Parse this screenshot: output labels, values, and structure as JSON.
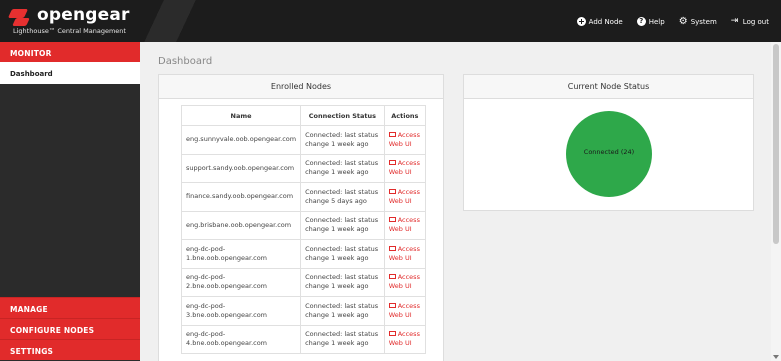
{
  "header": {
    "logo_text": "opengear",
    "logo_subtitle": "Lighthouse™ Central Management",
    "nav": [
      {
        "label": "Add Node",
        "icon": "plus-circle-icon"
      },
      {
        "label": "Help",
        "icon": "help-circle-icon"
      },
      {
        "label": "System",
        "icon": "gear-icon"
      },
      {
        "label": "Log out",
        "icon": "logout-icon"
      }
    ]
  },
  "sidebar": {
    "monitor_label": "MONITOR",
    "active_item": "Dashboard",
    "bottom_items": [
      "MANAGE",
      "CONFIGURE NODES",
      "SETTINGS"
    ]
  },
  "main": {
    "page_title": "Dashboard",
    "enrolled_title": "Enrolled Nodes",
    "status_title": "Current Node Status",
    "columns": [
      "Name",
      "Connection Status",
      "Actions"
    ],
    "rows": [
      {
        "name": "eng.sunnyvale.oob.opengear.com",
        "status": "Connected: last status change 1 week ago",
        "action": "Access Web UI"
      },
      {
        "name": "support.sandy.oob.opengear.com",
        "status": "Connected: last status change 1 week ago",
        "action": "Access Web UI"
      },
      {
        "name": "finance.sandy.oob.opengear.com",
        "status": "Connected: last status change 5 days ago",
        "action": "Access Web UI"
      },
      {
        "name": "eng.brisbane.oob.opengear.com",
        "status": "Connected: last status change 1 week ago",
        "action": "Access Web UI"
      },
      {
        "name": "eng-dc-pod-1.bne.oob.opengear.com",
        "status": "Connected: last status change 1 week ago",
        "action": "Access Web UI"
      },
      {
        "name": "eng-dc-pod-2.bne.oob.opengear.com",
        "status": "Connected: last status change 1 week ago",
        "action": "Access Web UI"
      },
      {
        "name": "eng-dc-pod-3.bne.oob.opengear.com",
        "status": "Connected: last status change 1 week ago",
        "action": "Access Web UI"
      },
      {
        "name": "eng-dc-pod-4.bne.oob.opengear.com",
        "status": "Connected: last status change 1 week ago",
        "action": "Access Web UI"
      }
    ],
    "donut_label": "Connected (24)",
    "donut_color": "#2ea84a"
  }
}
